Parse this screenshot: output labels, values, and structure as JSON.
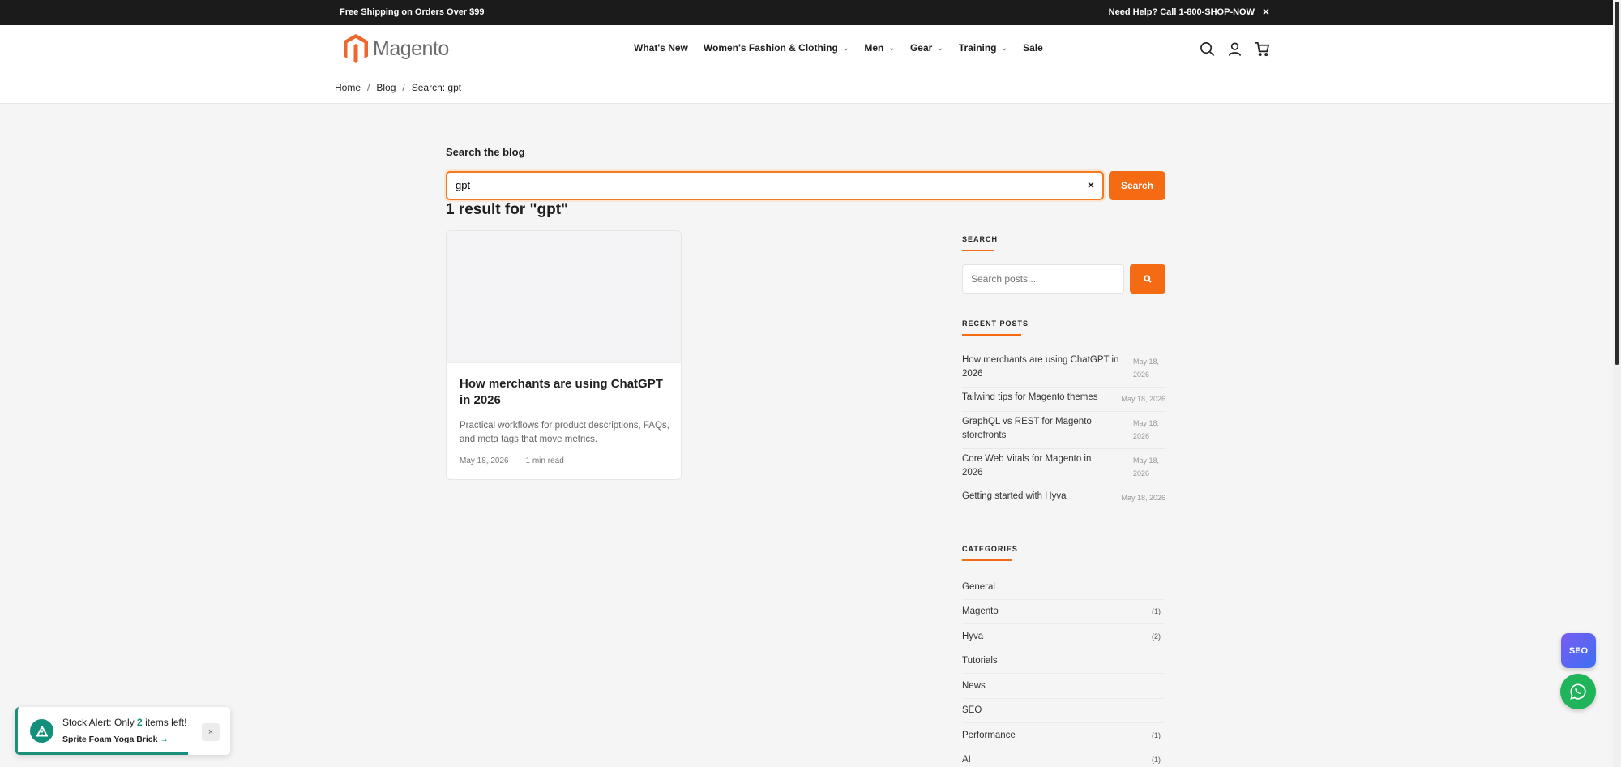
{
  "topbar": {
    "promo": "Free Shipping on Orders Over $99",
    "help": "Need Help? Call 1-800-SHOP-NOW",
    "close": "×"
  },
  "header": {
    "logo_text": "Magento",
    "nav": [
      {
        "label": "What's New",
        "dropdown": false
      },
      {
        "label": "Women's Fashion & Clothing",
        "dropdown": true
      },
      {
        "label": "Men",
        "dropdown": true
      },
      {
        "label": "Gear",
        "dropdown": true
      },
      {
        "label": "Training",
        "dropdown": true
      },
      {
        "label": "Sale",
        "dropdown": false
      }
    ],
    "icons": [
      "search-icon",
      "account-icon",
      "cart-icon"
    ]
  },
  "breadcrumb": {
    "items": [
      "Home",
      "Blog",
      "Search: gpt"
    ],
    "separator": "/"
  },
  "search": {
    "title": "Search the blog",
    "value": "gpt",
    "clear": "×",
    "button": "Search",
    "results_count": "1 result for \"gpt\""
  },
  "results": [
    {
      "title": "How merchants are using ChatGPT in 2026",
      "excerpt": "Practical workflows for product descriptions, FAQs, and meta tags that move metrics.",
      "date": "May 18, 2026",
      "dot": "·",
      "read": "1 min read"
    }
  ],
  "sidebar": {
    "search_heading": "SEARCH",
    "search_placeholder": "Search posts...",
    "recent_heading": "RECENT POSTS",
    "recent": [
      {
        "title": "How merchants are using ChatGPT in 2026",
        "date": "May 18, 2026"
      },
      {
        "title": "Tailwind tips for Magento themes",
        "date": "May 18, 2026"
      },
      {
        "title": "GraphQL vs REST for Magento storefronts",
        "date": "May 18, 2026"
      },
      {
        "title": "Core Web Vitals for Magento in 2026",
        "date": "May 18, 2026"
      },
      {
        "title": "Getting started with Hyva",
        "date": "May 18, 2026"
      }
    ],
    "categories_heading": "CATEGORIES",
    "categories": [
      {
        "name": "General",
        "count": ""
      },
      {
        "name": "Magento",
        "count": "(1)"
      },
      {
        "name": "Hyva",
        "count": "(2)"
      },
      {
        "name": "Tutorials",
        "count": ""
      },
      {
        "name": "News",
        "count": ""
      },
      {
        "name": "SEO",
        "count": ""
      },
      {
        "name": "Performance",
        "count": "(1)"
      },
      {
        "name": "AI",
        "count": "(1)"
      }
    ]
  },
  "floating": {
    "seo_label": "SEO"
  },
  "toast": {
    "prefix": "Stock Alert: Only ",
    "count": "2",
    "suffix": " items left!",
    "product": "Sprite Foam Yoga Brick",
    "arrow": "→",
    "close": "×",
    "progress": 0.8
  },
  "colors": {
    "accent": "#f46b14",
    "toast": "#13907b",
    "topbar": "#1b1b1b"
  }
}
